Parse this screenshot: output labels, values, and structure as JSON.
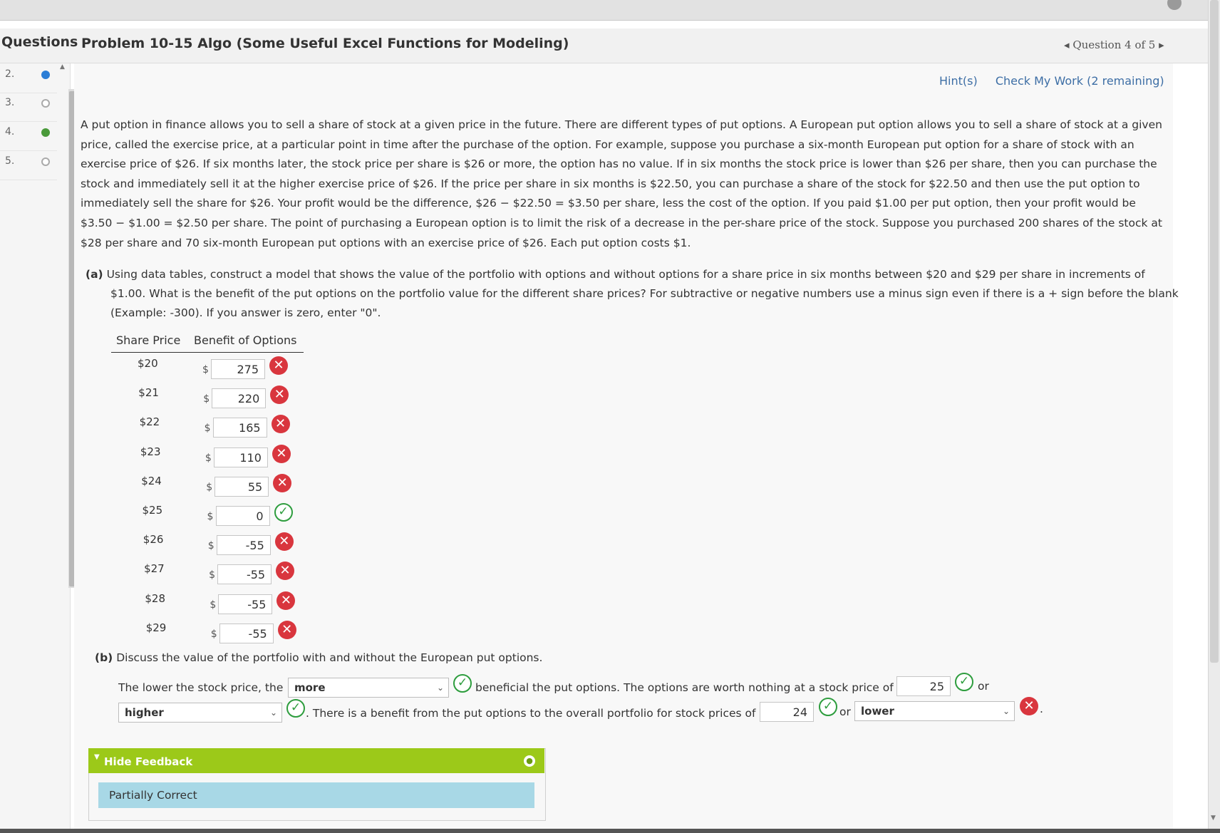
{
  "header": {
    "questions_label": "Questions",
    "problem_title": "Problem 10-15 Algo (Some Useful Excel Functions for Modeling)",
    "nav_prev": "◂",
    "nav_label": "Question 4 of 5",
    "nav_next": "▸"
  },
  "sidebar": {
    "items": [
      {
        "number": "2.",
        "status": "filled"
      },
      {
        "number": "3.",
        "status": "empty"
      },
      {
        "number": "4.",
        "status": "answered"
      },
      {
        "number": "5.",
        "status": "empty"
      }
    ]
  },
  "links": {
    "hints": "Hint(s)",
    "check": "Check My Work (2 remaining)"
  },
  "problem_text": "A put option in finance allows you to sell a share of stock at a given price in the future. There are different types of put options. A European put option allows you to sell a share of stock at a given price, called the exercise price, at a particular point in time after the purchase of the option. For example, suppose you purchase a six-month European put option for a share of stock with an exercise price of $26. If six months later, the stock price per share is $26 or more, the option has no value. If in six months the stock price is lower than $26 per share, then you can purchase the stock and immediately sell it at the higher exercise price of $26. If the price per share in six months is $22.50, you can purchase a share of the stock for $22.50 and then use the put option to immediately sell the share for $26. Your profit would be the difference, $26 − $22.50 = $3.50 per share, less the cost of the option. If you paid $1.00 per put option, then your profit would be $3.50 − $1.00 = $2.50 per share. The point of purchasing a European option is to limit the risk of a decrease in the per-share price of the stock. Suppose you purchased 200 shares of the stock at $28 per share and 70 six-month European put options with an exercise price of $26. Each put option costs $1.",
  "part_a": {
    "label": "(a)",
    "text": "Using data tables, construct a model that shows the value of the portfolio with options and without options for a share price in six months between $20 and $29 per share in increments of $1.00. What is the benefit of the put options on the portfolio value for the different share prices? For subtractive or negative numbers use a minus sign even if there is a + sign before the blank (Example: -300). If you answer is zero, enter \"0\"."
  },
  "table": {
    "header_price": "Share Price",
    "header_benefit": "Benefit of Options",
    "currency": "$",
    "rows": [
      {
        "price": "$20",
        "value": "275",
        "correct": false
      },
      {
        "price": "$21",
        "value": "220",
        "correct": false
      },
      {
        "price": "$22",
        "value": "165",
        "correct": false
      },
      {
        "price": "$23",
        "value": "110",
        "correct": false
      },
      {
        "price": "$24",
        "value": "55",
        "correct": false
      },
      {
        "price": "$25",
        "value": "0",
        "correct": true
      },
      {
        "price": "$26",
        "value": "-55",
        "correct": false
      },
      {
        "price": "$27",
        "value": "-55",
        "correct": false
      },
      {
        "price": "$28",
        "value": "-55",
        "correct": false
      },
      {
        "price": "$29",
        "value": "-55",
        "correct": false
      }
    ]
  },
  "part_b": {
    "label": "(b)",
    "text": "Discuss the value of the portfolio with and without the European put options.",
    "s1": "The lower the stock price, the",
    "select1": "more",
    "s2": "beneficial the put options. The options are worth nothing at a stock price of $",
    "input1": "25",
    "s3": "or",
    "select2": "higher",
    "s4": ". There is a benefit from the put options to the overall portfolio for stock prices of $",
    "input2": "24",
    "s5": "or",
    "select3": "lower",
    "s6": "."
  },
  "feedback": {
    "toggle": "Hide Feedback",
    "status": "Partially Correct"
  },
  "marks": {
    "wrong": "✕",
    "right": "✓"
  },
  "colors": {
    "accent_link": "#3d6ea5",
    "wrong": "#d9363e",
    "right": "#2e9d3e",
    "feedback_bar": "#9cc919",
    "feedback_status": "#a8d8e6"
  }
}
